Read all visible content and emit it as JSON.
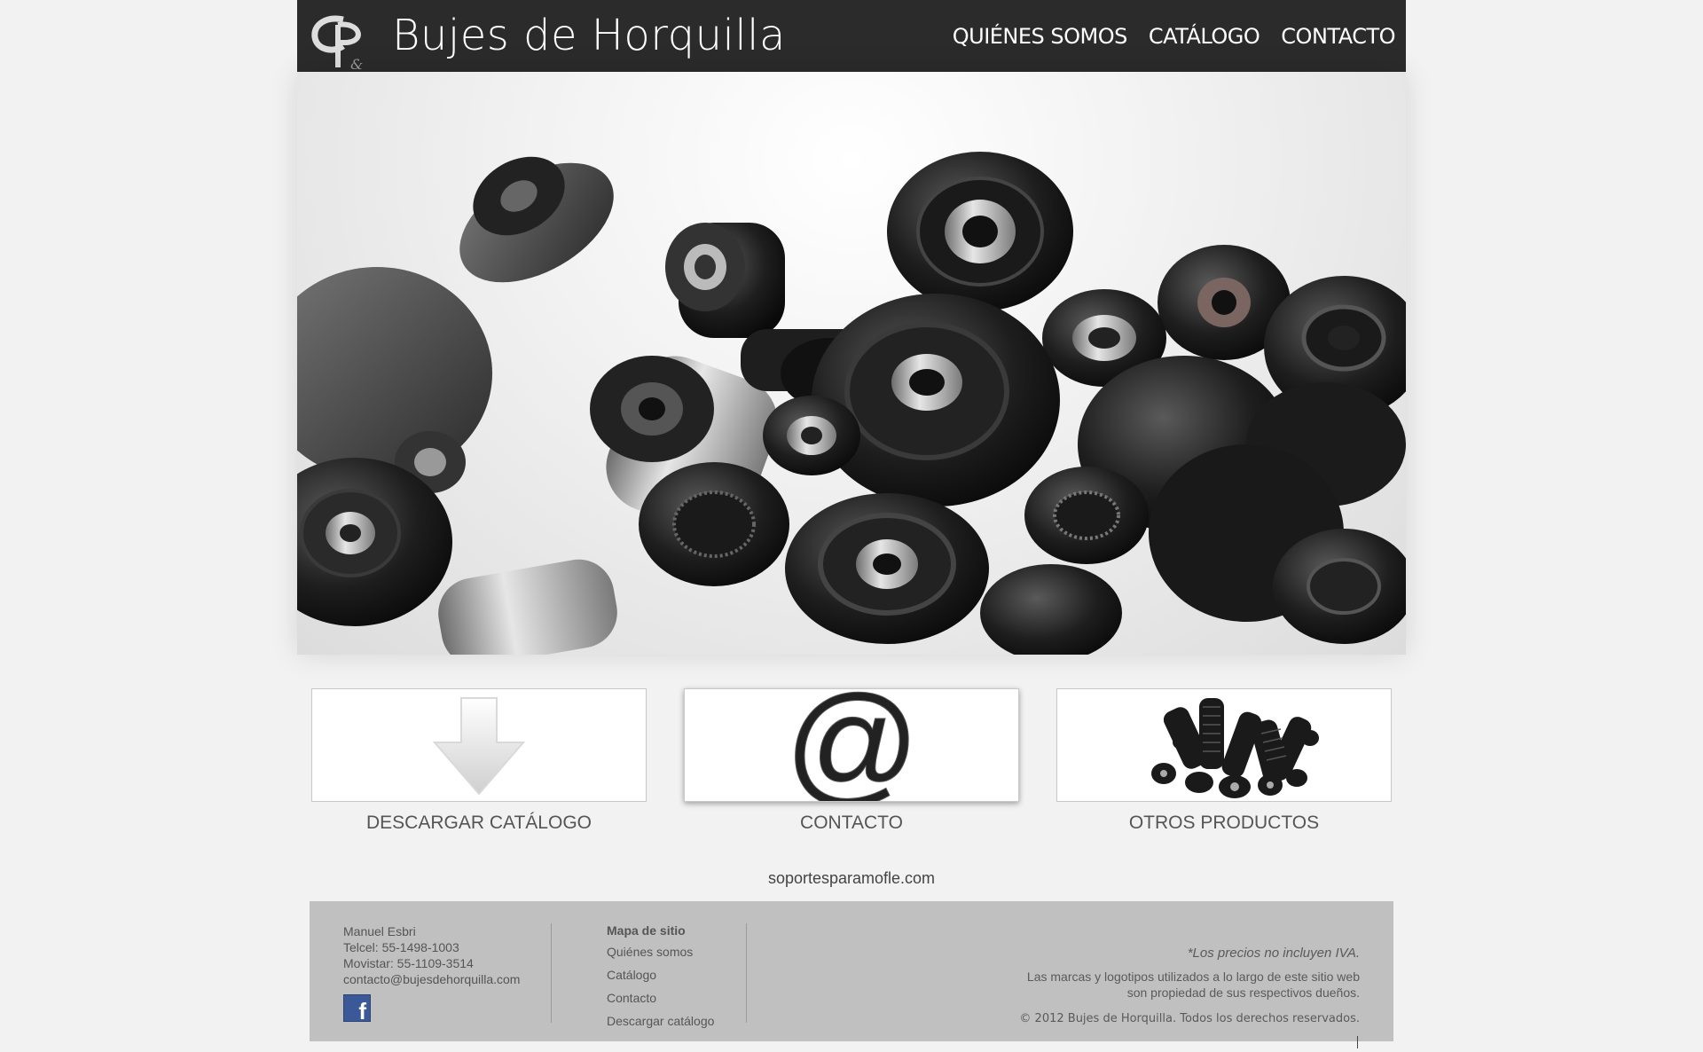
{
  "header": {
    "logo_text": "GP",
    "title": "Bujes de Horquilla",
    "nav": [
      {
        "label": "QUIÉNES SOMOS"
      },
      {
        "label": "CATÁLOGO"
      },
      {
        "label": "CONTACTO"
      }
    ]
  },
  "hero": {
    "image_alt": "bushings-photo"
  },
  "cards": [
    {
      "label": "DESCARGAR CATÁLOGO",
      "icon": "download-arrow-icon"
    },
    {
      "label": "CONTACTO",
      "icon": "at-sign-icon"
    },
    {
      "label": "OTROS PRODUCTOS",
      "icon": "products-photo-icon"
    }
  ],
  "site_link": "soportesparamofle.com",
  "footer": {
    "contact": {
      "name": "Manuel Esbri",
      "telcel": "Telcel: 55-1498-1003",
      "movistar": "Movistar: 55-1109-3514",
      "email": "contacto@bujesdehorquilla.com"
    },
    "sitemap": {
      "heading": "Mapa de sitio",
      "links": [
        "Quiénes somos",
        "Catálogo",
        "Contacto",
        "Descargar catálogo"
      ]
    },
    "notes": {
      "iva": "*Los precios no incluyen IVA.",
      "brands_line1": "Las marcas y logotipos utilizados a lo largo de este sitio web",
      "brands_line2": "son propiedad de sus respectivos dueños.",
      "copyright": "© 2012 Bujes de Horquilla. Todos los derechos reservados."
    },
    "facebook_icon": "facebook-icon"
  },
  "colors": {
    "header_bg": "#2b2b2b",
    "page_bg": "#f2f2f2",
    "footer_bg": "#c0c0c0",
    "facebook": "#3b5998"
  }
}
